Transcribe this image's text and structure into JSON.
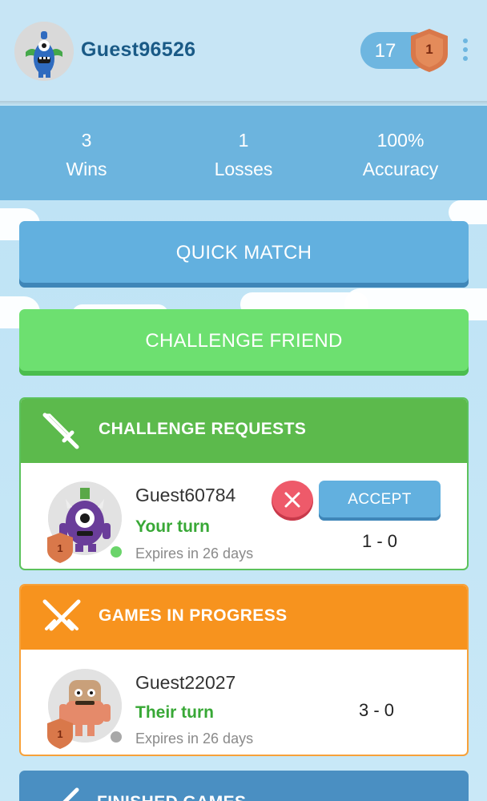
{
  "header": {
    "username": "Guest96526",
    "rank_number": "17",
    "badge_level": "1"
  },
  "stats": [
    {
      "value": "3",
      "label": "Wins"
    },
    {
      "value": "1",
      "label": "Losses"
    },
    {
      "value": "100%",
      "label": "Accuracy"
    }
  ],
  "buttons": {
    "quick_match": "QUICK MATCH",
    "challenge_friend": "CHALLENGE FRIEND"
  },
  "challenge_requests": {
    "title": "CHALLENGE REQUESTS",
    "item": {
      "name": "Guest60784",
      "turn": "Your turn",
      "expires": "Expires in 26 days",
      "score": "1 - 0",
      "badge_level": "1",
      "accept_label": "ACCEPT",
      "status_color": "#6ad46a"
    }
  },
  "games_in_progress": {
    "title": "GAMES IN PROGRESS",
    "item": {
      "name": "Guest22027",
      "turn": "Their turn",
      "expires": "Expires in 26 days",
      "score": "3 - 0",
      "badge_level": "1",
      "status_color": "#a8a8a8"
    }
  },
  "finished_games": {
    "title": "FINISHED GAMES"
  },
  "colors": {
    "header_bg": "#c7e5f5",
    "stats_bg": "#6cb4de",
    "quick_match": "#62b0df",
    "challenge_friend": "#6de070",
    "challenge_requests": "#5cba4c",
    "games_in_progress": "#f7931e",
    "finished_games": "#4a8fc2",
    "decline": "#ee5a6a",
    "badge_bronze": "#d9784a"
  },
  "icons": [
    "monster-avatar-icon",
    "bronze-badge-icon",
    "more-vert-icon",
    "sword-icon",
    "crossed-swords-icon",
    "close-icon"
  ]
}
